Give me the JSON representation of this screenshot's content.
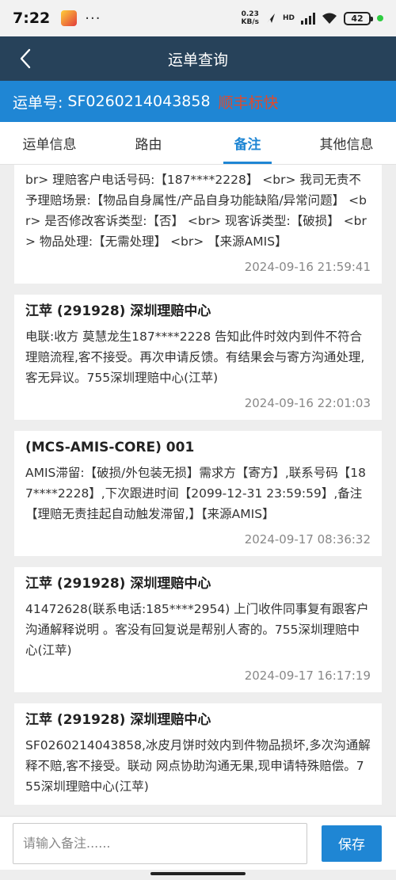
{
  "status": {
    "time": "7:22",
    "dots": "···",
    "speed_value": "0.23",
    "speed_unit": "KB/s",
    "hd": "HD",
    "battery": "42"
  },
  "header": {
    "title": "运单查询",
    "back_icon": "chevron-left-icon"
  },
  "waybill": {
    "label": "运单号:",
    "number": "SF0260214043858",
    "tag": "顺丰标快"
  },
  "tabs": [
    {
      "label": "运单信息"
    },
    {
      "label": "路由"
    },
    {
      "label": "备注",
      "active": true
    },
    {
      "label": "其他信息"
    }
  ],
  "notes": [
    {
      "author": "",
      "content": "【当前工单已申请理赔无责挂起】<br> 理赔客户:【寄方】 <br> 理赔客户电话号码:【187****2228】 <br> 我司无责不予理赔场景:【物品自身属性/产品自身功能缺陷/异常问题】 <br> 是否修改客诉类型:【否】 <br> 现客诉类型:【破损】 <br> 物品处理:【无需处理】 <br> 【来源AMIS】",
      "time": "2024-09-16 21:59:41"
    },
    {
      "author": "江苹 (291928) 深圳理赔中心",
      "content": "电联:收方 莫慧龙生187****2228 告知此件时效内到件不符合理赔流程,客不接受。再次申请反馈。有结果会与寄方沟通处理,客无异议。755深圳理赔中心(江苹)",
      "time": "2024-09-16 22:01:03"
    },
    {
      "author": " (MCS-AMIS-CORE) 001",
      "content": "AMIS滞留:【破损/外包装无损】需求方【寄方】,联系号码【187****2228】,下次跟进时间【2099-12-31 23:59:59】,备注【理赔无责挂起自动触发滞留,】【来源AMIS】",
      "time": "2024-09-17 08:36:32"
    },
    {
      "author": "江苹 (291928) 深圳理赔中心",
      "content": "41472628(联系电话:185****2954) 上门收件同事复有跟客户沟通解释说明 。客没有回复说是帮别人寄的。755深圳理赔中心(江苹)",
      "time": "2024-09-17 16:17:19"
    },
    {
      "author": "江苹 (291928) 深圳理赔中心",
      "content": "SF0260214043858,冰皮月饼时效内到件物品损坏,多次沟通解释不赔,客不接受。联动 网点协助沟通无果,现申请特殊赔偿。755深圳理赔中心(江苹)",
      "time": ""
    }
  ],
  "input": {
    "placeholder": "请输入备注......",
    "value": "",
    "save_label": "保存"
  }
}
